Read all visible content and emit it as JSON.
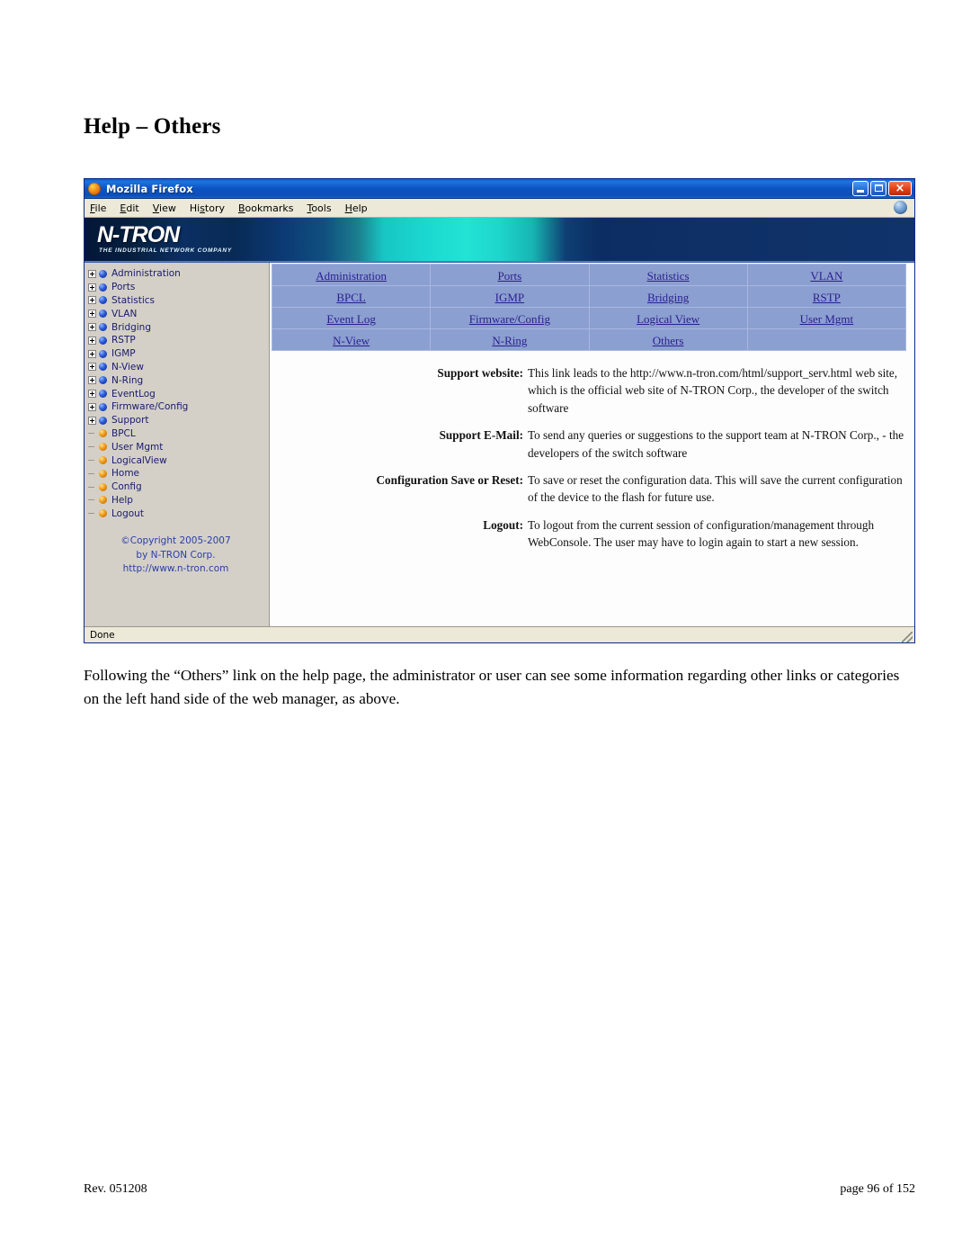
{
  "page": {
    "heading": "Help – Others",
    "paragraph": "Following the “Others” link on the help page, the administrator or user can see some information regarding other links or categories on the left hand side of the web manager, as above.",
    "footer_left": "Rev.  051208",
    "footer_right": "page 96 of 152"
  },
  "browser": {
    "title": "Mozilla Firefox",
    "menus": [
      {
        "label": "File",
        "accel": "F"
      },
      {
        "label": "Edit",
        "accel": "E"
      },
      {
        "label": "View",
        "accel": "V"
      },
      {
        "label": "History",
        "accel": "s"
      },
      {
        "label": "Bookmarks",
        "accel": "B"
      },
      {
        "label": "Tools",
        "accel": "T"
      },
      {
        "label": "Help",
        "accel": "H"
      }
    ],
    "window_buttons": {
      "minimize": "Minimize",
      "maximize": "Maximize",
      "close": "×"
    },
    "status": "Done"
  },
  "banner": {
    "logo": "N-TRON",
    "tagline": "THE INDUSTRIAL NETWORK COMPANY"
  },
  "sidebar": {
    "items": [
      {
        "label": "Administration",
        "expandable": true,
        "dot": "blue"
      },
      {
        "label": "Ports",
        "expandable": true,
        "dot": "blue"
      },
      {
        "label": "Statistics",
        "expandable": true,
        "dot": "blue"
      },
      {
        "label": "VLAN",
        "expandable": true,
        "dot": "blue"
      },
      {
        "label": "Bridging",
        "expandable": true,
        "dot": "blue"
      },
      {
        "label": "RSTP",
        "expandable": true,
        "dot": "blue"
      },
      {
        "label": "IGMP",
        "expandable": true,
        "dot": "blue"
      },
      {
        "label": "N-View",
        "expandable": true,
        "dot": "blue"
      },
      {
        "label": "N-Ring",
        "expandable": true,
        "dot": "blue"
      },
      {
        "label": "EventLog",
        "expandable": true,
        "dot": "blue"
      },
      {
        "label": "Firmware/Config",
        "expandable": true,
        "dot": "blue"
      },
      {
        "label": "Support",
        "expandable": true,
        "dot": "blue"
      },
      {
        "label": "BPCL",
        "expandable": false,
        "dot": "orange"
      },
      {
        "label": "User Mgmt",
        "expandable": false,
        "dot": "orange"
      },
      {
        "label": "LogicalView",
        "expandable": false,
        "dot": "orange"
      },
      {
        "label": "Home",
        "expandable": false,
        "dot": "orange"
      },
      {
        "label": "Config",
        "expandable": false,
        "dot": "orange"
      },
      {
        "label": "Help",
        "expandable": false,
        "dot": "orange"
      },
      {
        "label": "Logout",
        "expandable": false,
        "dot": "orange"
      }
    ],
    "copyright": {
      "line1": "©Copyright 2005-2007",
      "line2": "by N-TRON Corp.",
      "line3": "http://www.n-tron.com"
    }
  },
  "link_grid": {
    "rows": [
      [
        "Administration",
        "Ports",
        "Statistics",
        "VLAN"
      ],
      [
        "BPCL",
        "IGMP",
        "Bridging",
        "RSTP"
      ],
      [
        "Event Log",
        "Firmware/Config",
        "Logical View",
        "User Mgmt"
      ],
      [
        "N-View",
        "N-Ring",
        "Others",
        ""
      ]
    ]
  },
  "help_entries": [
    {
      "label": "Support website:",
      "description": "This link leads to the http://www.n-tron.com/html/support_serv.html web site, which is the official web site of N-TRON Corp., the developer of the switch software"
    },
    {
      "label": "Support E-Mail:",
      "description": "To send any queries or suggestions to the support team at N-TRON Corp., - the developers of the switch software"
    },
    {
      "label": "Configuration Save or Reset:",
      "description": "To save or reset the configuration data. This will save the current configuration of the device to the flash for future use."
    },
    {
      "label": "Logout:",
      "description": "To logout from the current session of configuration/management through WebConsole. The user may have to login again to start a new session."
    }
  ],
  "colors": {
    "titlebar": "#0b54c4",
    "sidebar_bg": "#d4d0c8",
    "link_cell_bg": "#8b9fd0",
    "link_text": "#2b1f8f",
    "tree_text": "#1a1a6e",
    "copyright_text": "#2b3ea8",
    "banner_cyan": "#22e3d4",
    "banner_navy": "#0f3168"
  }
}
